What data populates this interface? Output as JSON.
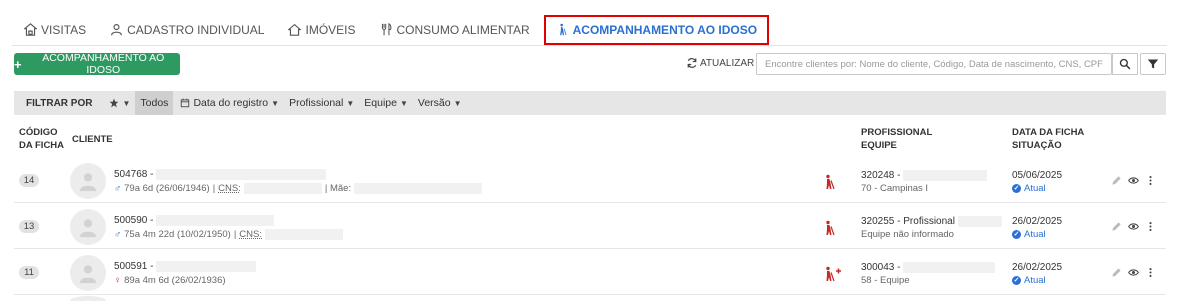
{
  "tabs": [
    {
      "label": "VISITAS",
      "icon": "home-visit-icon"
    },
    {
      "label": "CADASTRO INDIVIDUAL",
      "icon": "person-icon"
    },
    {
      "label": "IMÓVEIS",
      "icon": "house-icon"
    },
    {
      "label": "CONSUMO ALIMENTAR",
      "icon": "cutlery-icon"
    },
    {
      "label": "ACOMPANHAMENTO AO IDOSO",
      "icon": "elderly-walker-icon",
      "active": true
    }
  ],
  "toolbar": {
    "new_button_label": "ACOMPANHAMENTO AO IDOSO",
    "refresh_label": "ATUALIZAR",
    "search_placeholder": "Encontre clientes por: Nome do cliente, Código, Data de nascimento, CNS, CPF"
  },
  "filterbar": {
    "label": "FILTRAR POR",
    "all_label": "Todos",
    "items": [
      "Data do registro",
      "Profissional",
      "Equipe",
      "Versão"
    ]
  },
  "table": {
    "headers": {
      "code_line1": "CÓDIGO",
      "code_line2": "DA FICHA",
      "client": "CLIENTE",
      "prof_line1": "PROFISSIONAL",
      "prof_line2": "EQUIPE",
      "date_line1": "DATA DA FICHA",
      "date_line2": "SITUAÇÃO"
    },
    "rows": [
      {
        "code": "14",
        "client_id": "504768 -",
        "sex_symbol": "♂",
        "age": "79a 6d (26/06/1946)",
        "sep1": "|",
        "cns_label": "CNS:",
        "sep2": "| Mãe:",
        "professional": "320248 -",
        "team": "70 - Campinas I",
        "date": "05/06/2025",
        "status": "Atual",
        "status_color": "#2a6fd1"
      },
      {
        "code": "13",
        "client_id": "500590 -",
        "sex_symbol": "♂",
        "age": "75a 4m 22d (10/02/1950)",
        "sep1": "|",
        "cns_label": "CNS:",
        "professional": "320255 - Profissional",
        "team": "Equipe não informado",
        "date": "26/02/2025",
        "status": "Atual",
        "status_color": "#2a6fd1"
      },
      {
        "code": "11",
        "client_id": "500591 -",
        "sex_symbol": "♀",
        "age": "89a 4m 6d (26/02/1936)",
        "professional": "300043 -",
        "team": "58 - Equipe",
        "date": "26/02/2025",
        "status": "Atual",
        "status_color": "#2a6fd1"
      }
    ]
  },
  "colors": {
    "primary_green": "#2d9a62",
    "accent_blue": "#2a6fd1",
    "active_tab_border": "#e00000",
    "walker_red": "#c62828"
  }
}
